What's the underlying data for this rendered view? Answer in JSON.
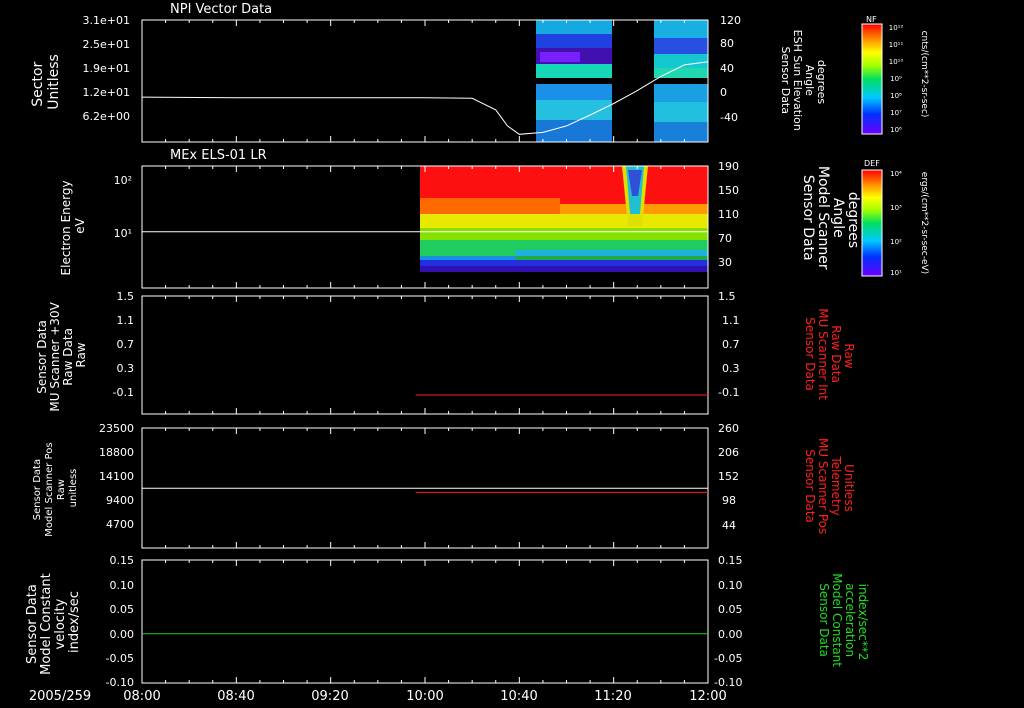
{
  "colors": {
    "background": "#000000",
    "text": "#ffffff",
    "right_axis_red": "#ff2020",
    "right_axis_green": "#22dd22",
    "trace_white": "#ffffff",
    "trace_red": "#ff2020",
    "trace_green": "#22cc22"
  },
  "time_axis": {
    "date_label": "2005/259",
    "ticks": [
      "08:00",
      "08:40",
      "09:20",
      "10:00",
      "10:40",
      "11:20",
      "12:00"
    ],
    "range": [
      "08:00",
      "12:00"
    ]
  },
  "panels": [
    {
      "title": "NPI Vector Data",
      "left_label": [
        "Sector",
        "Unitless"
      ],
      "left_ticks": [
        "3.1e+01",
        "2.5e+01",
        "1.9e+01",
        "1.2e+01",
        "6.2e+00"
      ],
      "right_label": [
        "Sensor Data",
        "ESH Sun Elevation",
        "Angle",
        "degrees"
      ],
      "right_ticks": [
        "120",
        "80",
        "40",
        "0",
        "-40"
      ],
      "colorbar": {
        "title": "NF",
        "unit": "cnts/(cm**2-sr-sec)",
        "ticks": [
          "10¹²",
          "10¹¹",
          "10¹⁰",
          "10⁹",
          "10⁸",
          "10⁷",
          "10⁶"
        ]
      }
    },
    {
      "title": "MEx ELS-01 LR",
      "left_label": [
        "Electron Energy",
        "eV"
      ],
      "left_ticks": [
        "10²",
        "10¹"
      ],
      "right_label": [
        "Sensor Data",
        "Model Scanner",
        "Angle",
        "degrees"
      ],
      "right_ticks": [
        "190",
        "150",
        "110",
        "70",
        "30"
      ],
      "colorbar": {
        "title": "DEF",
        "unit": "ergs/(cm**2-sr-sec-eV)",
        "ticks": [
          "10⁴",
          "10³",
          "10²",
          "10¹"
        ]
      }
    },
    {
      "left_label": [
        "Sensor Data",
        "MU Scanner +30V",
        "Raw Data",
        "Raw"
      ],
      "left_ticks": [
        "1.5",
        "1.1",
        "0.7",
        "0.3",
        "-0.1"
      ],
      "right_label": [
        "Sensor Data",
        "MU Scanner Int",
        "Raw Data",
        "Raw"
      ],
      "right_ticks": [
        "1.5",
        "1.1",
        "0.7",
        "0.3",
        "-0.1"
      ]
    },
    {
      "left_label": [
        "Sensor Data",
        "Model Scanner Pos",
        "Raw",
        "unitless"
      ],
      "left_ticks": [
        "23500",
        "18800",
        "14100",
        "9400",
        "4700"
      ],
      "right_label": [
        "Sensor Data",
        "MU Scanner Pos",
        "Telemetry",
        "Unitless"
      ],
      "right_ticks": [
        "260",
        "206",
        "152",
        "98",
        "44"
      ]
    },
    {
      "left_label": [
        "Sensor Data",
        "Model Constant",
        "velocity",
        "index/sec"
      ],
      "left_ticks": [
        "0.15",
        "0.10",
        "0.05",
        "0.00",
        "-0.05",
        "-0.10"
      ],
      "right_label": [
        "Sensor Data",
        "Model Constant",
        "acceleration",
        "index/sec**2"
      ],
      "right_ticks": [
        "0.15",
        "0.10",
        "0.05",
        "0.00",
        "-0.05",
        "-0.10"
      ]
    }
  ],
  "chart_data": {
    "type": "line",
    "x_range": [
      "08:00",
      "12:00"
    ],
    "panels": [
      {
        "kind": "spectrogram+line",
        "ylim_right": [
          -70,
          120
        ],
        "line": {
          "x": [
            "08:00",
            "08:40",
            "09:20",
            "10:00",
            "10:20",
            "10:30",
            "10:35",
            "10:40",
            "10:50",
            "11:00",
            "11:10",
            "11:20",
            "11:30",
            "11:40",
            "11:50",
            "12:00"
          ],
          "y": [
            0,
            -1,
            -1,
            -1,
            -2,
            -20,
            -45,
            -58,
            -55,
            -45,
            -28,
            -10,
            10,
            32,
            50,
            55
          ]
        },
        "spectrogram_intervals": [
          [
            "10:35",
            "11:10"
          ],
          [
            "11:30",
            "12:00"
          ]
        ]
      },
      {
        "kind": "spectrogram+line",
        "ylim_right": [
          10,
          190
        ],
        "line": {
          "x": [
            "08:00",
            "12:00"
          ],
          "y": [
            93,
            93
          ]
        },
        "spectrogram_intervals": [
          [
            "09:59",
            "12:00"
          ]
        ]
      },
      {
        "kind": "line",
        "ylim": [
          -0.3,
          1.5
        ],
        "series": [
          {
            "x": [
              "09:56",
              "12:00"
            ],
            "y": [
              -0.01,
              -0.01
            ],
            "color": "red"
          }
        ]
      },
      {
        "kind": "line",
        "ylim_left": [
          0,
          23500
        ],
        "ylim_right": [
          -10,
          260
        ],
        "series": [
          {
            "x": [
              "08:00",
              "12:00"
            ],
            "y": [
              11700,
              11700
            ],
            "color": "white",
            "axis": "left"
          },
          {
            "x": [
              "09:56",
              "12:00"
            ],
            "y": [
              115,
              115
            ],
            "color": "red",
            "axis": "right"
          }
        ]
      },
      {
        "kind": "line",
        "ylim": [
          -0.1,
          0.15
        ],
        "series": [
          {
            "x": [
              "08:00",
              "12:00"
            ],
            "y": [
              0.0,
              0.0
            ],
            "color": "green"
          }
        ]
      }
    ]
  }
}
